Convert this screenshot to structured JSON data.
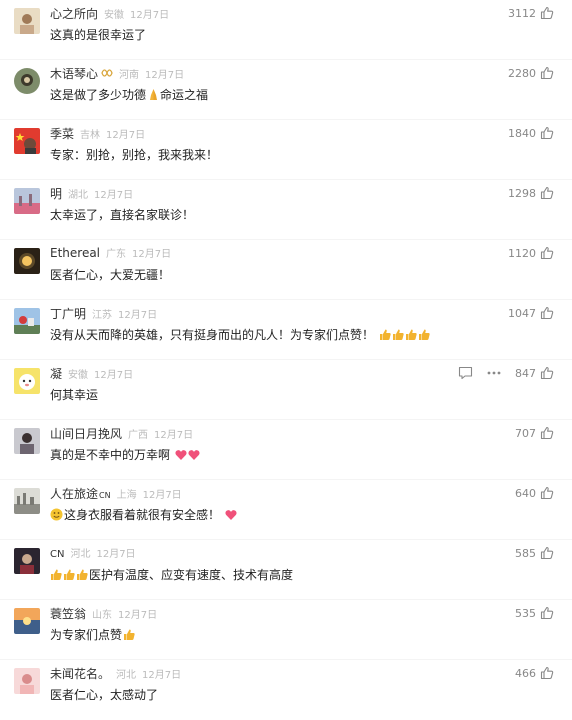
{
  "icons": {
    "like": "thumb-up-outline-icon",
    "reply": "comment-bubble-icon",
    "more": "more-dots-icon"
  },
  "comments": [
    {
      "username": "心之所向",
      "location": "安徽",
      "date": "12月7日",
      "text": "这真的是很幸运了",
      "likes": "3112"
    },
    {
      "username": "木语琴心",
      "location": "河南",
      "date": "12月7日",
      "text": "这是做了多少功德",
      "text_suffix": "命运之福",
      "likes": "2280"
    },
    {
      "username": "季菜",
      "location": "吉林",
      "date": "12月7日",
      "text": "专家：别抢，别抢，我来我来！",
      "likes": "1840"
    },
    {
      "username": "明",
      "location": "湖北",
      "date": "12月7日",
      "text": "太幸运了，直接名家联诊！",
      "likes": "1298"
    },
    {
      "username": "Ethereal",
      "location": "广东",
      "date": "12月7日",
      "text": "医者仁心，大爱无疆！",
      "likes": "1120"
    },
    {
      "username": "丁广明",
      "location": "江苏",
      "date": "12月7日",
      "text": "没有从天而降的英雄，只有挺身而出的凡人！为专家们点赞！",
      "likes": "1047"
    },
    {
      "username": "凝",
      "location": "安徽",
      "date": "12月7日",
      "text": "何其幸运",
      "likes": "847"
    },
    {
      "username": "山间日月挽风",
      "location": "广西",
      "date": "12月7日",
      "text": "真的是不幸中的万幸啊",
      "likes": "707"
    },
    {
      "username": "人在旅途",
      "username_sup": "CN",
      "location": "上海",
      "date": "12月7日",
      "text": "这身衣服看着就很有安全感！",
      "likes": "640"
    },
    {
      "username": "CN",
      "location": "河北",
      "date": "12月7日",
      "text": "医护有温度、应变有速度、技术有高度",
      "likes": "585"
    },
    {
      "username": "蓑笠翁",
      "location": "山东",
      "date": "12月7日",
      "text": "为专家们点赞",
      "likes": "535"
    },
    {
      "username": "未闻花名。",
      "location": "河北",
      "date": "12月7日",
      "text": "医者仁心，太感动了",
      "likes": "466"
    }
  ]
}
